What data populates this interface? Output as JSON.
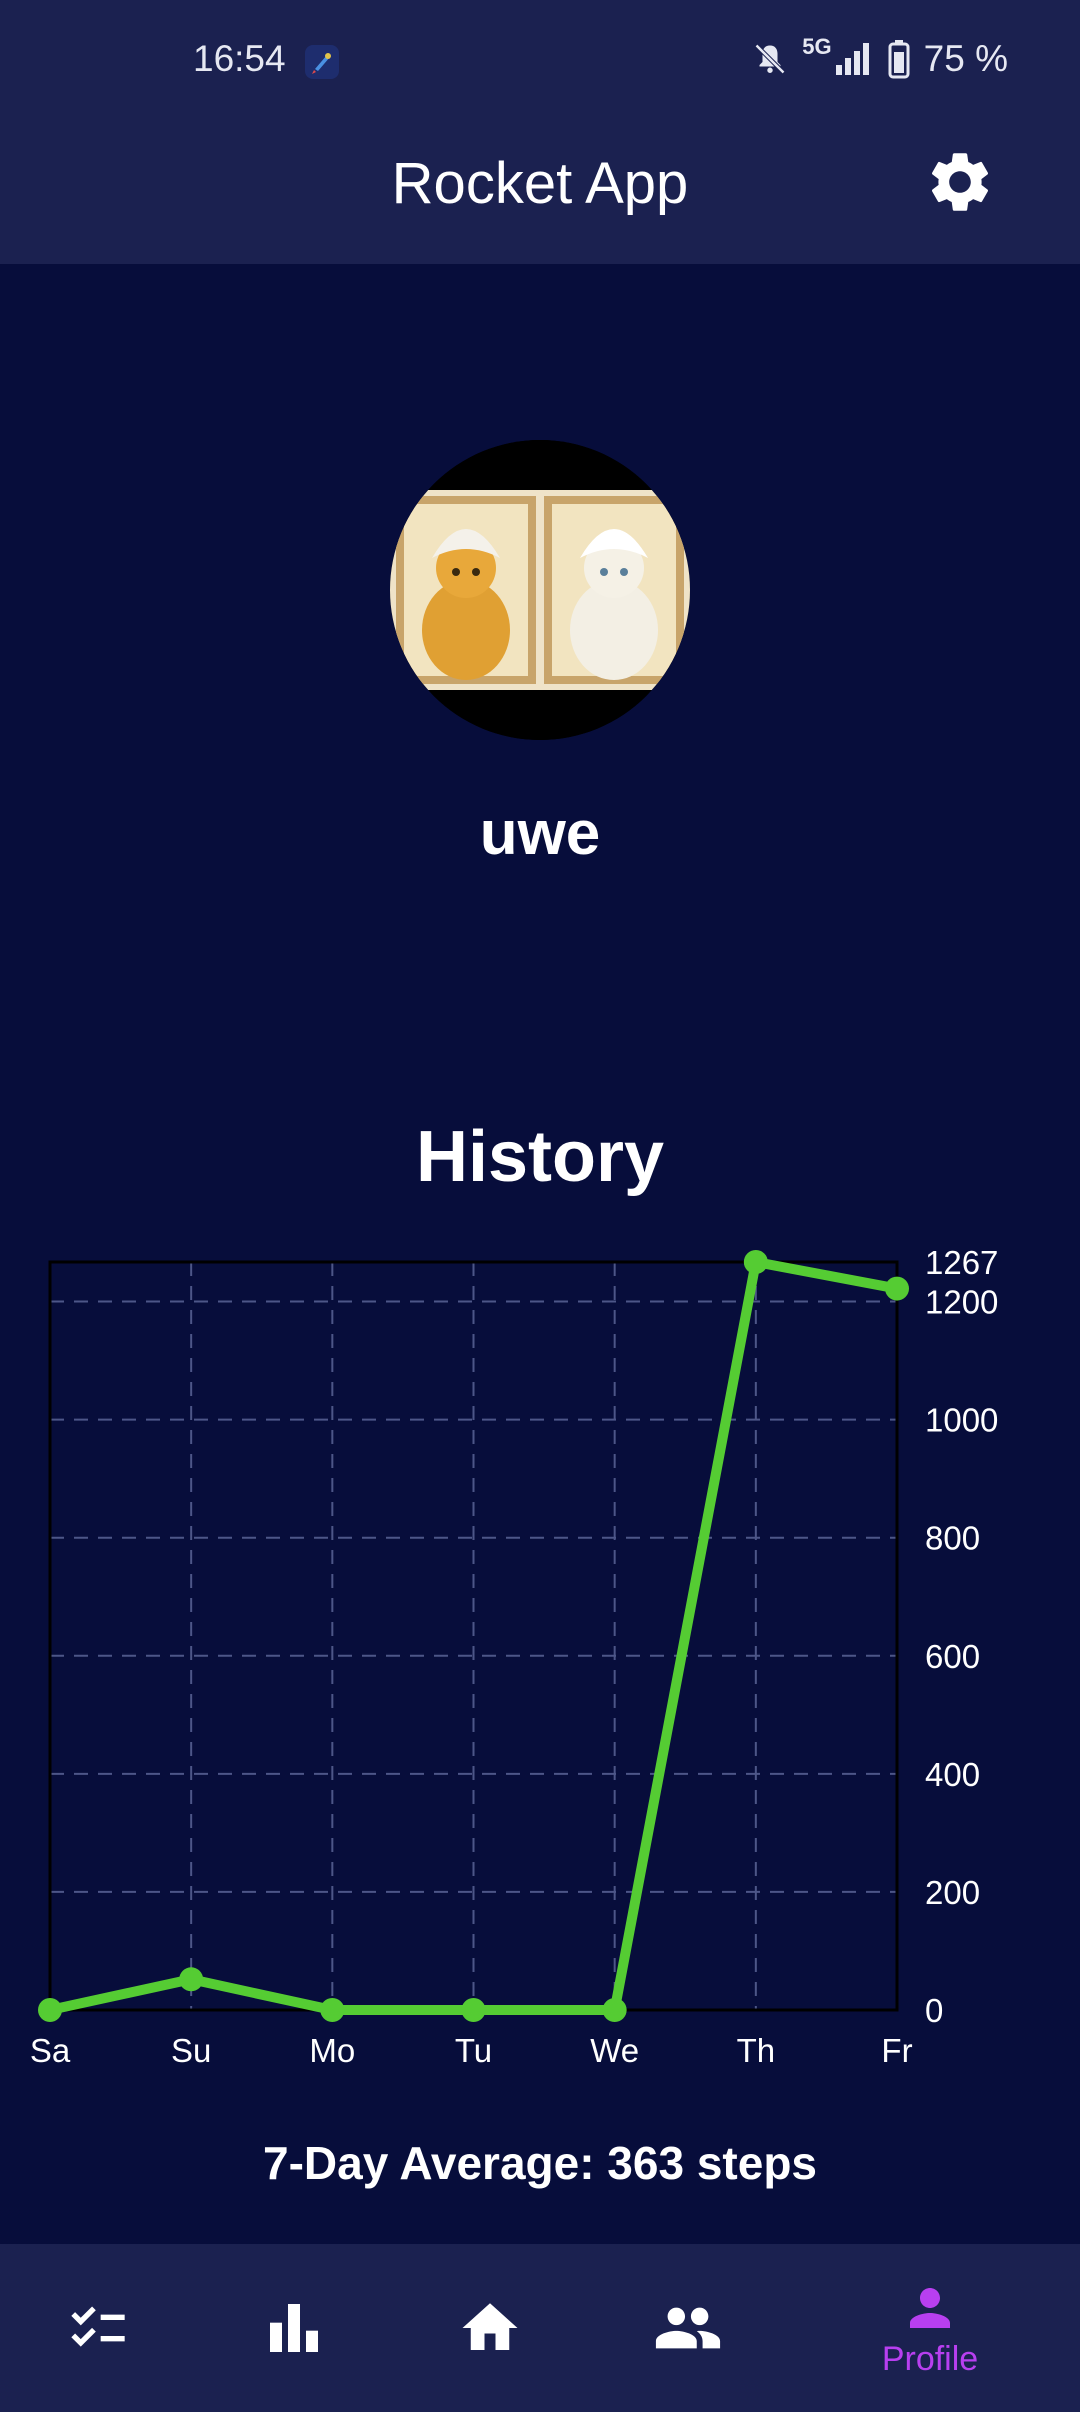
{
  "status_bar": {
    "time": "16:54",
    "network": "5G",
    "battery": "75 %",
    "icons": [
      "rocket-app-icon",
      "bell-muted-icon",
      "signal-icon",
      "battery-icon"
    ]
  },
  "header": {
    "title": "Rocket App",
    "settings_icon": "gear-icon"
  },
  "profile": {
    "username": "uwe",
    "avatar": "avatar-image"
  },
  "history": {
    "title": "History",
    "average_text": "7-Day Average: 363 steps"
  },
  "chart_data": {
    "type": "line",
    "categories": [
      "Sa",
      "Su",
      "Mo",
      "Tu",
      "We",
      "Th",
      "Fr"
    ],
    "series": [
      {
        "values": [
          0,
          52,
          0,
          0,
          0,
          1267,
          1222
        ],
        "color": "#55cc33"
      }
    ],
    "yticks": [
      0,
      200,
      400,
      600,
      800,
      1000,
      1200,
      1267
    ],
    "ylim": [
      0,
      1267
    ],
    "grid": true,
    "y_axis_side": "right"
  },
  "bottom_nav": {
    "items": [
      {
        "icon": "checklist-icon",
        "label": "",
        "active": false
      },
      {
        "icon": "bar-chart-icon",
        "label": "",
        "active": false
      },
      {
        "icon": "home-icon",
        "label": "",
        "active": false
      },
      {
        "icon": "people-icon",
        "label": "",
        "active": false
      },
      {
        "icon": "person-icon",
        "label": "Profile",
        "active": true
      }
    ]
  },
  "colors": {
    "background": "#070d3b",
    "bar": "#1b2150",
    "accent": "#b83ff0",
    "line": "#55cc33"
  }
}
